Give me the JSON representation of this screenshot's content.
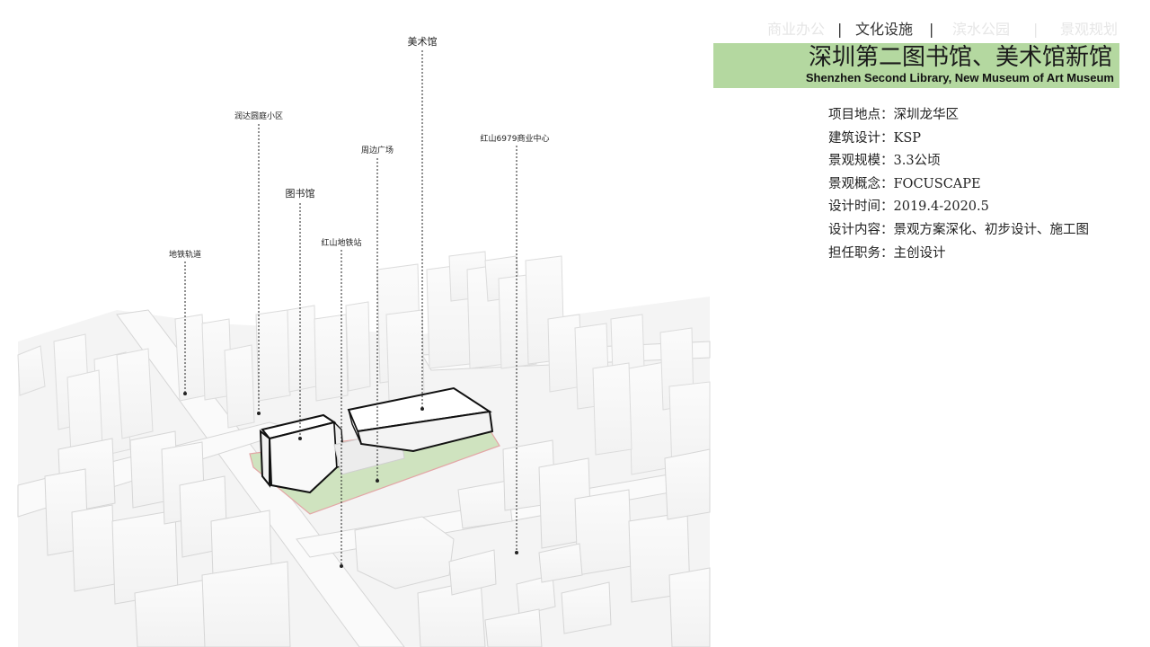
{
  "nav": {
    "items": [
      "商业办公",
      "文化设施",
      "滨水公园",
      "景观规划"
    ],
    "active_index": 1
  },
  "title": {
    "cn": "深圳第二图书馆、美术馆新馆",
    "en": "Shenzhen Second Library, New Museum of Art Museum"
  },
  "info": [
    {
      "label": "项目地点：",
      "value": "深圳龙华区"
    },
    {
      "label": "建筑设计：",
      "value": "KSP"
    },
    {
      "label": "景观规模：",
      "value": "3.3公顷"
    },
    {
      "label": "景观概念：",
      "value": "FOCUSCAPE"
    },
    {
      "label": "设计时间：",
      "value": "2019.4-2020.5"
    },
    {
      "label": "设计内容：",
      "value": "景观方案深化、初步设计、施工图"
    },
    {
      "label": "担任职务：",
      "value": "主创设计"
    }
  ],
  "callouts": {
    "museum": "美术馆",
    "residential": "润达圆庭小区",
    "plaza": "周边广场",
    "commercial": "红山6979商业中心",
    "library": "图书馆",
    "metro_station": "红山地铁站",
    "metro_track": "地铁轨道"
  },
  "colors": {
    "title_band": "#b4d8a0",
    "site_green": "#cfe3bf",
    "outline": "#111111"
  }
}
